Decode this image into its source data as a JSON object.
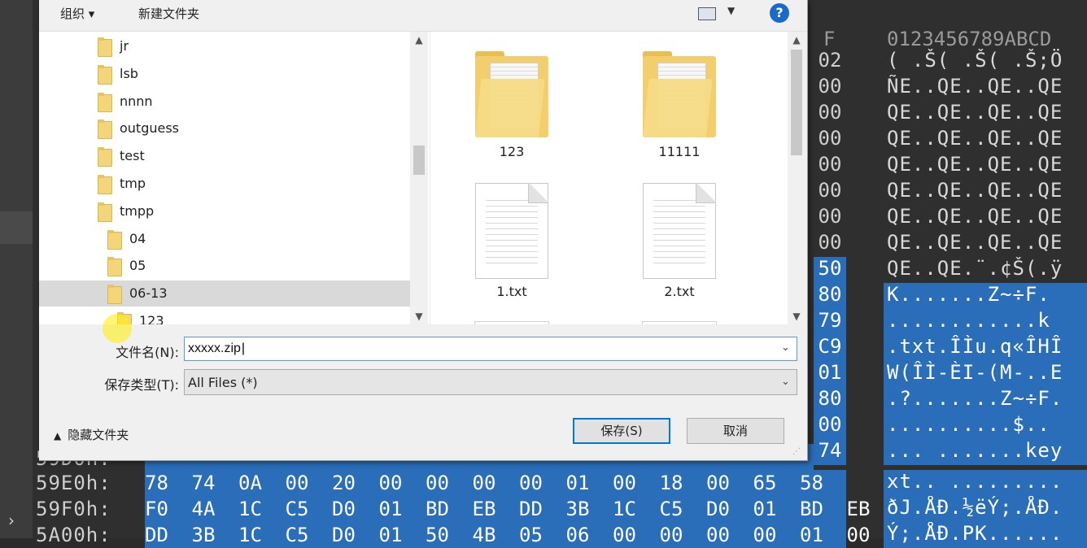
{
  "hex_editor": {
    "column_header_last": "F",
    "column_header_ascii": "0123456789ABCD",
    "rows": [
      {
        "last": "02",
        "ascii": "( .Š( .Š( .Š;Ö",
        "sel": false
      },
      {
        "last": "00",
        "ascii": "ÑE..QE..QE..QE",
        "sel": false
      },
      {
        "last": "00",
        "ascii": "QE..QE..QE..QE",
        "sel": false
      },
      {
        "last": "00",
        "ascii": "QE..QE..QE..QE",
        "sel": false
      },
      {
        "last": "00",
        "ascii": "QE..QE..QE..QE",
        "sel": false
      },
      {
        "last": "00",
        "ascii": "QE..QE..QE..QE",
        "sel": false
      },
      {
        "last": "00",
        "ascii": "QE..QE..QE..QE",
        "sel": false
      },
      {
        "last": "00",
        "ascii": "QE..QE..QE..QE",
        "sel": false
      },
      {
        "last": "50",
        "ascii": "QE..QE.¨.¢Š(.ÿ",
        "sel": true,
        "ascii_sel": false
      },
      {
        "last": "80",
        "ascii": "K.......Z~÷F.",
        "sel": true,
        "ascii_sel": true
      },
      {
        "last": "79",
        "ascii": "............k",
        "sel": true,
        "ascii_sel": true
      },
      {
        "last": "C9",
        "ascii": ".txt.ÎÌu.q«ÎHÎ",
        "sel": true,
        "ascii_sel": true
      },
      {
        "last": "01",
        "ascii": "W(ÎÌ-ÈI-(M-..E",
        "sel": true,
        "ascii_sel": true
      },
      {
        "last": "80",
        "ascii": ".?.......Z~÷F.",
        "sel": true,
        "ascii_sel": true
      },
      {
        "last": "00",
        "ascii": "..........$..",
        "sel": true,
        "ascii_sel": true
      },
      {
        "last": "74",
        "ascii": "... .......key",
        "sel": true,
        "ascii_sel": true
      }
    ],
    "bottom_rows": [
      {
        "addr": "59E0h:",
        "bytes": [
          "78",
          "74",
          "0A",
          "00",
          "20",
          "00",
          "00",
          "00",
          "00",
          "01",
          "00",
          "18",
          "00",
          "65",
          "58"
        ]
      },
      {
        "addr": "59F0h:",
        "bytes": [
          "F0",
          "4A",
          "1C",
          "C5",
          "D0",
          "01",
          "BD",
          "EB",
          "DD",
          "3B",
          "1C",
          "C5",
          "D0",
          "01",
          "BD",
          "EB"
        ]
      },
      {
        "addr": "5A00h:",
        "bytes": [
          "DD",
          "3B",
          "1C",
          "C5",
          "D0",
          "01",
          "50",
          "4B",
          "05",
          "06",
          "00",
          "00",
          "00",
          "00",
          "01",
          "00"
        ]
      }
    ],
    "bottom_ascii": [
      "xt.. .........",
      "ðJ.ÅÐ.½ëÝ;.ÅÐ.",
      "Ý;.ÅÐ.PK......"
    ],
    "partial_addr": "59D0h:"
  },
  "dialog": {
    "toolbar": {
      "organize_label": "组织 ▾",
      "new_folder_label": "新建文件夹",
      "help_label": "?"
    },
    "tree": [
      {
        "label": "jr",
        "level": 1
      },
      {
        "label": "lsb",
        "level": 1
      },
      {
        "label": "nnnn",
        "level": 1
      },
      {
        "label": "outguess",
        "level": 1
      },
      {
        "label": "test",
        "level": 1
      },
      {
        "label": "tmp",
        "level": 1
      },
      {
        "label": "tmpp",
        "level": 1
      },
      {
        "label": "04",
        "level": 2
      },
      {
        "label": "05",
        "level": 2
      },
      {
        "label": "06-13",
        "level": 2,
        "selected": true
      },
      {
        "label": "123",
        "level": 3
      }
    ],
    "files": [
      {
        "label": "123",
        "kind": "folder"
      },
      {
        "label": "11111",
        "kind": "folder"
      },
      {
        "label": "1.txt",
        "kind": "text"
      },
      {
        "label": "2.txt",
        "kind": "text"
      }
    ],
    "filename_label": "文件名(N):",
    "filename_value": "xxxxx.zip",
    "filetype_label": "保存类型(T):",
    "filetype_value": "All Files  (*)",
    "hide_folders_label": "隐藏文件夹",
    "save_label": "保存(S)",
    "cancel_label": "取消"
  }
}
